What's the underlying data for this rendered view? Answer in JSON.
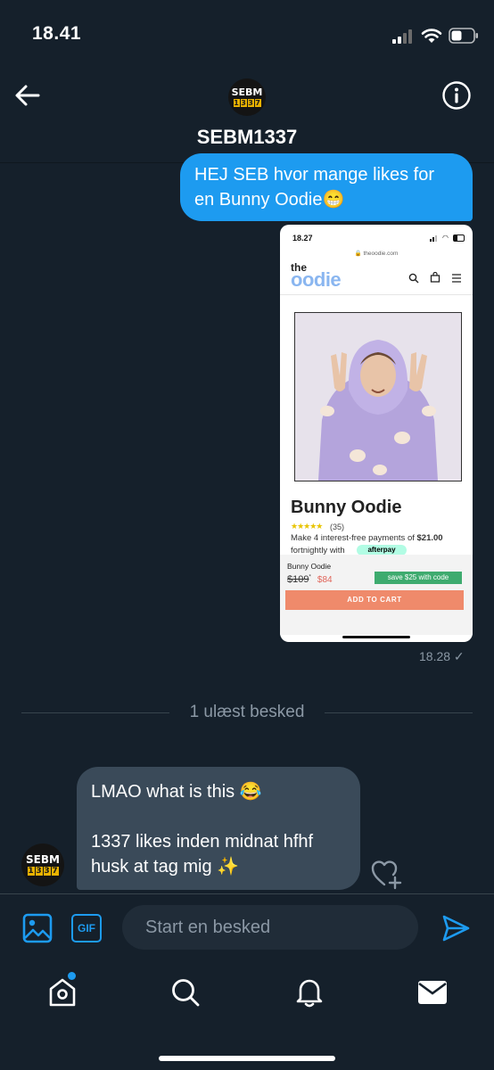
{
  "status_bar": {
    "time": "18.41"
  },
  "header": {
    "avatar_text_top": "SEBM",
    "avatar_text_digits": [
      "1",
      "3",
      "3",
      "7"
    ],
    "title": "SEBM1337"
  },
  "messages": {
    "outgoing_text": "HEJ SEB hvor mange likes for en Bunny Oodie😁",
    "shared_image": {
      "phone_time": "18.27",
      "url": "theoodie.com",
      "logo_the": "the",
      "logo_oodie": "oodie",
      "product_title": "Bunny Oodie",
      "stars": "★★★★★",
      "review_count": "(35)",
      "pay_line1_prefix": "Make 4 interest-free payments of ",
      "pay_amount": "$21.00",
      "pay_line2": "fortnightly with",
      "afterpay": "afterpay",
      "bar_product": "Bunny Oodie",
      "old_price": "$109",
      "old_price_mark": "*",
      "new_price": "$84",
      "save_badge": "save $25 with code",
      "cart_button": "ADD TO CART"
    },
    "sent_time": "18.28 ✓",
    "unread_label": "1 ulæst besked",
    "incoming_line1": "LMAO what is this 😂",
    "incoming_line2": "1337 likes inden midnat hfhf",
    "incoming_line3": "husk at tag mig ✨"
  },
  "composer": {
    "gif_label": "GIF",
    "placeholder": "Start en besked"
  },
  "colors": {
    "background": "#15202b",
    "accent": "#1d9bf0",
    "incoming_bubble": "#3a4a59"
  }
}
